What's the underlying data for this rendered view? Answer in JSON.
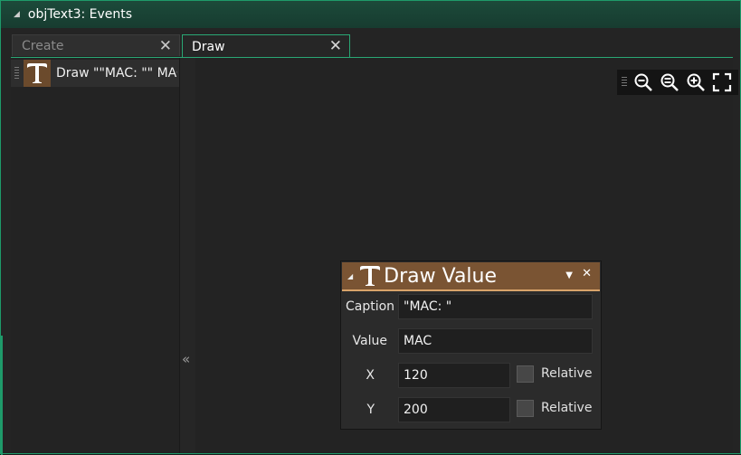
{
  "window": {
    "title": "objText3: Events"
  },
  "tabs": [
    {
      "label": "Create",
      "close": "✕"
    },
    {
      "label": "Draw",
      "close": "✕"
    }
  ],
  "action_list": {
    "items": [
      {
        "label": "Draw \"\"MAC: \"\" MAC",
        "icon": "text-t-icon"
      }
    ]
  },
  "splitter": {
    "glyph": "«"
  },
  "zoom_toolbar": {
    "icons": [
      "zoom-out-icon",
      "zoom-reset-icon",
      "zoom-in-icon",
      "fit-screen-icon"
    ]
  },
  "panel": {
    "title": "Draw Value",
    "dropdown_glyph": "▼",
    "close_glyph": "✕",
    "fields": {
      "caption_label": "Caption",
      "caption_value": "\"MAC: \"",
      "value_label": "Value",
      "value_value": "MAC",
      "x_label": "X",
      "x_value": "120",
      "y_label": "Y",
      "y_value": "200",
      "relative_label": "Relative"
    }
  },
  "colors": {
    "accent": "#2aa774",
    "titlebar": "#1c4a3a",
    "action_brown": "#7a5433",
    "action_underline": "#d8a36a"
  }
}
